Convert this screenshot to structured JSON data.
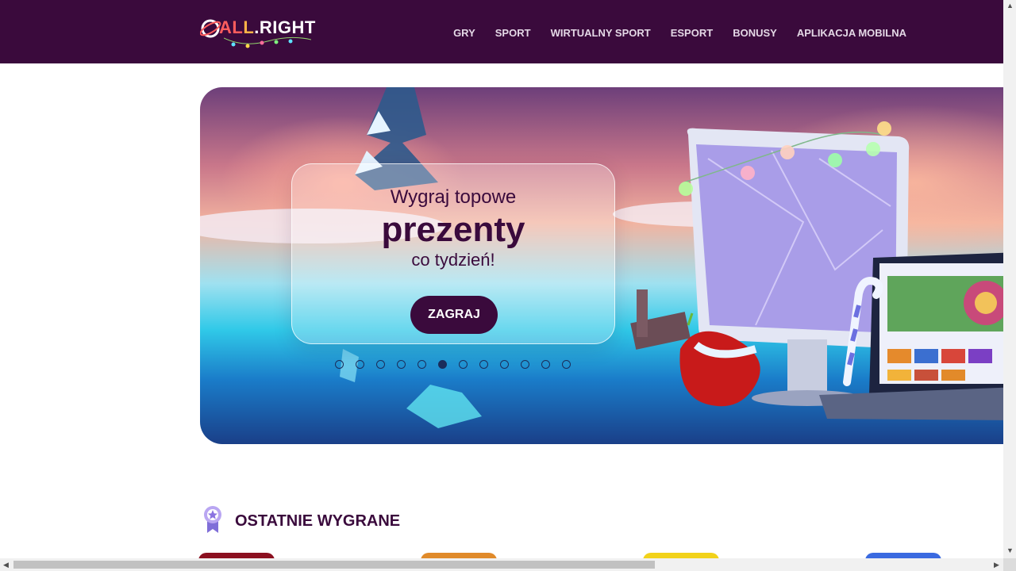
{
  "header": {
    "logo_text_a": "AL",
    "logo_text_b": "L",
    "logo_text_c": "RIGHT",
    "nav": [
      "GRY",
      "SPORT",
      "WIRTUALNY SPORT",
      "ESPORT",
      "BONUSY",
      "APLIKACJA MOBILNA"
    ]
  },
  "banner": {
    "line1": "Wygraj topowe",
    "line2": "prezenty",
    "line3": "co tydzień!",
    "cta": "ZAGRAJ",
    "slides_total": 12,
    "active_slide": 6
  },
  "section": {
    "title": "OSTATNIE WYGRANE"
  },
  "colors": {
    "brand": "#3a0a3c",
    "nav_text": "#e4d8e6",
    "dot": "#1b2d5c"
  }
}
